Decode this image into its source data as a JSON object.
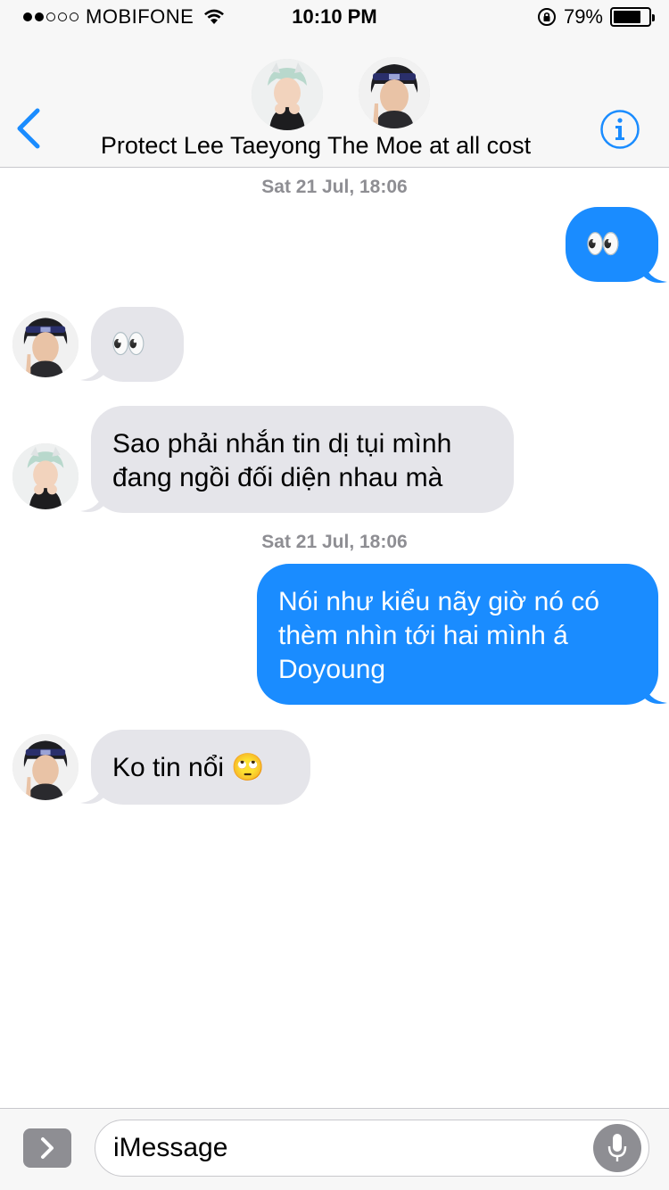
{
  "status_bar": {
    "carrier": "MOBIFONE",
    "time": "10:10 PM",
    "battery_percent": "79%",
    "battery_level": 0.79,
    "signal_bars_filled": 2,
    "signal_bars_total": 5,
    "icons": [
      "wifi-icon",
      "rotation-lock-icon",
      "battery-icon"
    ]
  },
  "header": {
    "title": "Protect Lee Taeyong The Moe at all cost",
    "back_icon": "chevron-left-icon",
    "info_icon": "info-icon",
    "accent_color": "#1a8cff"
  },
  "messages": [
    {
      "type": "timestamp",
      "text": "Sat 21 Jul, 18:06"
    },
    {
      "type": "outgoing",
      "text": "👀"
    },
    {
      "type": "incoming",
      "sender_avatar": "headband-boy",
      "text": "👀"
    },
    {
      "type": "incoming",
      "sender_avatar": "mint-hair-boy",
      "lines": [
        "Sao phải nhắn tin dị tụi mình",
        "đang ngồi đối diện nhau mà"
      ]
    },
    {
      "type": "timestamp",
      "text": "Sat 21 Jul, 18:06"
    },
    {
      "type": "outgoing",
      "lines": [
        "Nói như kiểu nãy giờ nó có",
        "thèm nhìn tới hai mình á",
        "Doyoung"
      ]
    },
    {
      "type": "incoming",
      "sender_avatar": "headband-boy",
      "text": "Ko tin nổi 🙄"
    }
  ],
  "input_bar": {
    "placeholder": "iMessage",
    "apps_icon": "chevron-right-icon",
    "mic_icon": "microphone-icon"
  },
  "colors": {
    "outgoing_bubble": "#1a8cff",
    "incoming_bubble": "#e5e5ea",
    "timestamp": "#8e8e93",
    "bar_background": "#f7f7f7"
  }
}
